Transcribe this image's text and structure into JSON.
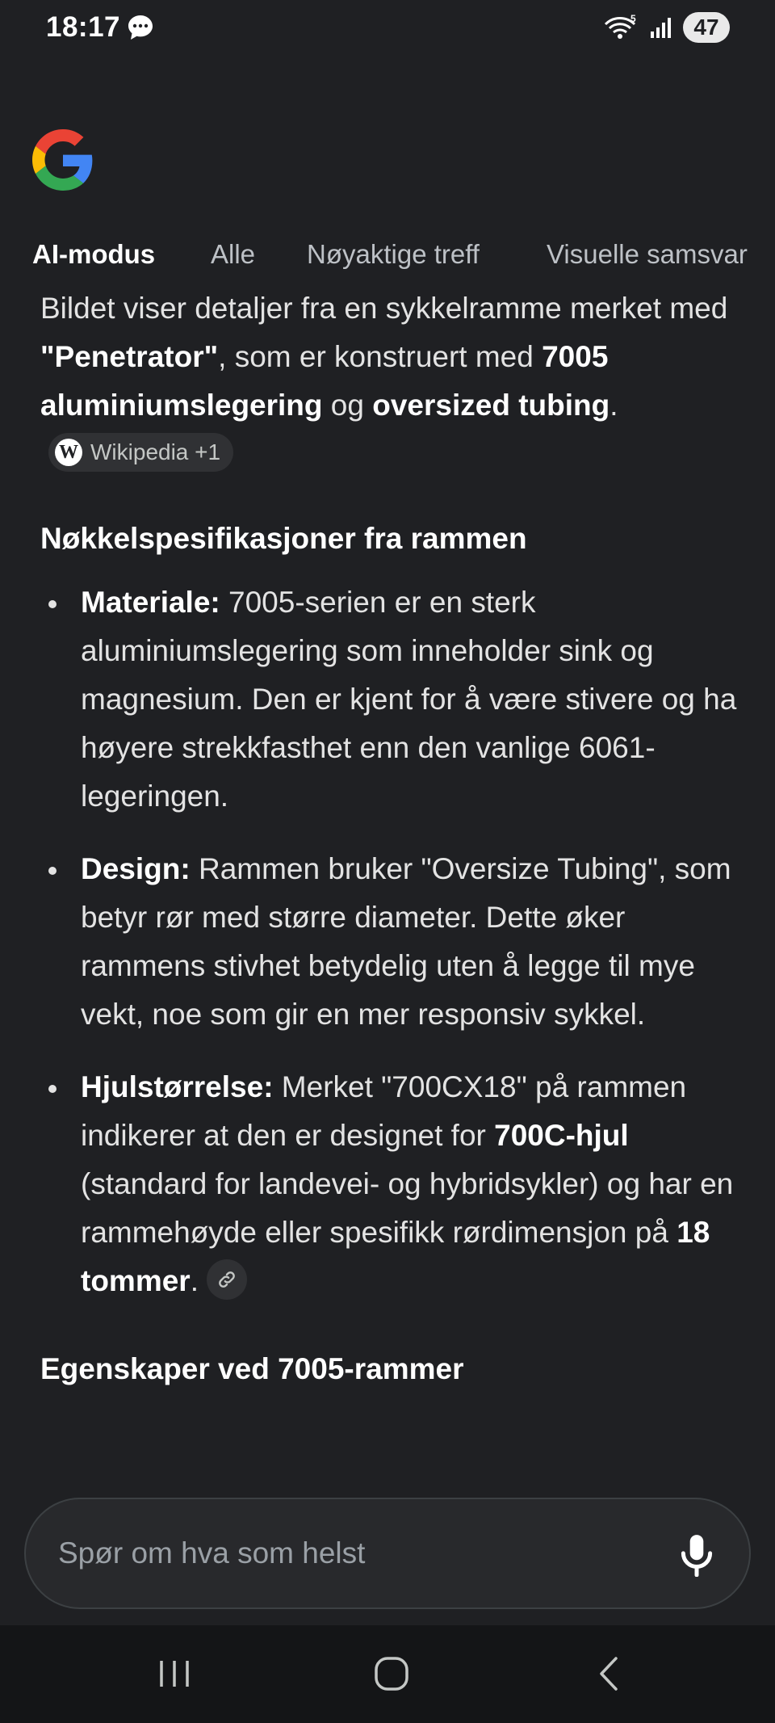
{
  "status_bar": {
    "time": "18:17",
    "wifi_badge": "5",
    "battery": "47",
    "icons": [
      "message-icon",
      "wifi-icon",
      "signal-icon"
    ]
  },
  "header": {
    "logo": "google-g-logo",
    "tabs": [
      {
        "label": "AI-modus",
        "active": true
      },
      {
        "label": "Alle",
        "active": false
      },
      {
        "label": "Nøyaktige treff",
        "active": false
      },
      {
        "label": "Visuelle samsvar",
        "active": false
      }
    ]
  },
  "answer": {
    "intro": {
      "t1": "Bildet viser detaljer fra en sykkelramme merket med ",
      "b1": "\"Penetrator\"",
      "t2": ", som er konstruert med ",
      "b2": "7005 aluminiumslegering",
      "t3": " og ",
      "b3": "oversized tubing",
      "t4": ".",
      "source_chip": "Wikipedia +1"
    },
    "section1_title": "Nøkkelspesifikasjoner fra rammen",
    "bullets": [
      {
        "label": "Materiale:",
        "text": " 7005-serien er en sterk aluminiumslegering som inneholder sink og magnesium. Den er kjent for å være stivere og ha høyere strekkfasthet enn den vanlige 6061-legeringen."
      },
      {
        "label": "Design:",
        "text": " Rammen bruker \"Oversize Tubing\", som betyr rør med større diameter. Dette øker rammens stivhet betydelig uten å legge til mye vekt, noe som gir en mer responsiv sykkel."
      },
      {
        "label": "Hjulstørrelse:",
        "t1": " Merket \"700CX18\" på rammen indikerer at den er designet for ",
        "b1": "700C-hjul",
        "t2": " (standard for landevei- og hybridsykler) og har en rammehøyde eller spesifikk rørdimensjon på ",
        "b2": "18 tommer",
        "t3": "."
      }
    ],
    "section2_title": "Egenskaper ved 7005-rammer"
  },
  "search": {
    "placeholder": "Spør om hva som helst"
  },
  "nav": {
    "buttons": [
      "recent-apps",
      "home",
      "back"
    ]
  },
  "colors": {
    "background": "#1f2023",
    "text": "#e3e3e3",
    "chip": "#303134"
  }
}
